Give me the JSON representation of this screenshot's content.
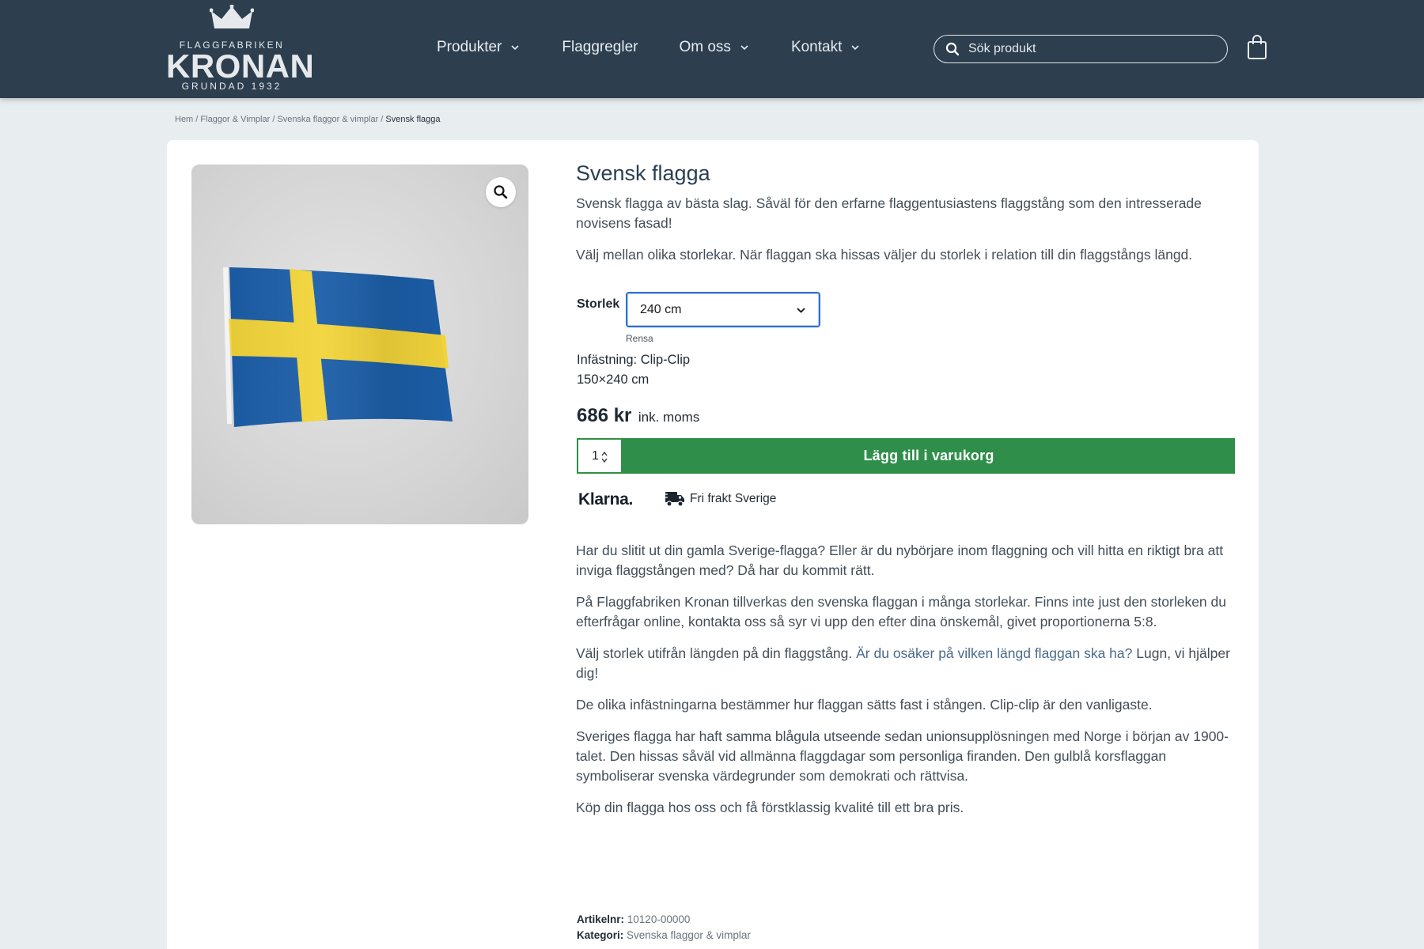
{
  "header": {
    "logo": {
      "line1": "FLAGGFABRIKEN",
      "name": "KRONAN",
      "founded": "GRUNDAD 1932"
    },
    "nav": [
      {
        "label": "Produkter",
        "has_dropdown": true
      },
      {
        "label": "Flaggregler",
        "has_dropdown": false
      },
      {
        "label": "Om oss",
        "has_dropdown": true
      },
      {
        "label": "Kontakt",
        "has_dropdown": true
      }
    ],
    "search_placeholder": "Sök produkt",
    "icons": {
      "search": "search-icon",
      "cart": "shopping-bag-icon"
    }
  },
  "breadcrumb": {
    "items": [
      "Hem",
      "Flaggor & Vimplar",
      "Svenska flaggor & vimplar"
    ],
    "separator": "/",
    "current": "Svensk flagga"
  },
  "product": {
    "title": "Svensk flagga",
    "intro1": "Svensk flagga av bästa slag. Såväl för den erfarne flaggentusiastens flaggstång som den intresserade novisens fasad!",
    "intro2": "Välj mellan olika storlekar. När flaggan ska hissas väljer du storlek i relation till din flaggstångs längd.",
    "size_label": "Storlek",
    "size_value": "240 cm",
    "clear_label": "Rensa",
    "attachment": "Infästning: Clip-Clip",
    "dimensions": "150×240 cm",
    "price": "686 kr",
    "tax_note": "ink. moms",
    "quantity": "1",
    "add_to_cart": "Lägg till i varukorg",
    "klarna": "Klarna.",
    "free_shipping": "Fri frakt Sverige",
    "image_zoom_icon": "magnifier-icon"
  },
  "description": {
    "p1": "Har du slitit ut din gamla Sverige-flagga? Eller är du nybörjare inom flaggning och vill hitta en riktigt bra att inviga flaggstången med? Då har du kommit rätt.",
    "p2": "På Flaggfabriken Kronan tillverkas den svenska flaggan i många storlekar. Finns inte just den storleken du efterfrågar online, kontakta oss så syr vi upp den efter dina önskemål, givet proportionerna 5:8.",
    "p3_before": "Välj storlek utifrån längden på din flaggstång. ",
    "p3_link": "Är du osäker på vilken längd flaggan ska ha?",
    "p3_after": " Lugn, vi hjälper dig!",
    "p4": "De olika infästningarna bestämmer hur flaggan sätts fast i stången. Clip-clip är den vanligaste.",
    "p5": "Sveriges flagga har haft samma blågula utseende sedan unionsupplösningen med Norge i början av 1900-talet. Den hissas såväl vid allmänna flaggdagar som personliga firanden. Den gulblå korsflaggan symboliserar svenska värdegrunder som demokrati och rättvisa.",
    "p6": "Köp din flagga hos oss och få förstklassig kvalité till ett bra pris."
  },
  "meta": {
    "sku_label": "Artikelnr:",
    "sku": "10120-00000",
    "category_label": "Kategori:",
    "category": "Svenska flaggor & vimplar"
  },
  "colors": {
    "header_bg": "#2d3e4e",
    "page_bg": "#e8edf0",
    "accent_green": "#2f8f4a",
    "flag_blue": "#1c5ea8",
    "flag_yellow": "#f2d43a"
  }
}
